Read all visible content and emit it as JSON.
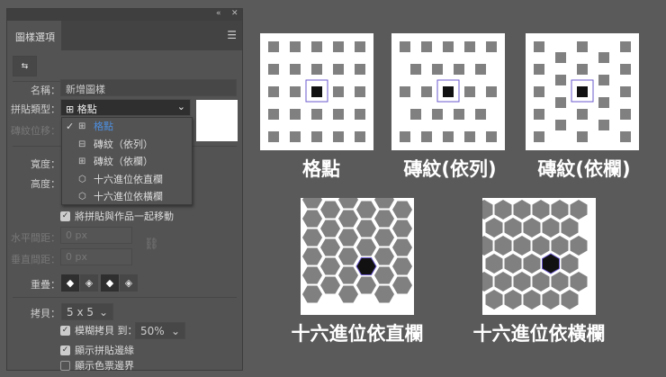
{
  "panel": {
    "title": "圖樣選項",
    "collapse_icon": "«",
    "close_icon": "✕",
    "menu_icon": "☰",
    "fit_tile_icon": "⇆",
    "name_label": "名稱：",
    "name_value": "新增圖樣",
    "tile_type_label": "拼貼類型：",
    "tile_type_value": "格點",
    "brick_offset_label": "磚紋位移：",
    "width_label": "寬度：",
    "height_label": "高度：",
    "tile_types": [
      {
        "icon": "⊞",
        "label": "格點",
        "selected": true
      },
      {
        "icon": "⊟",
        "label": "磚紋（依列）"
      },
      {
        "icon": "⊞",
        "label": "磚紋（依欄）"
      },
      {
        "icon": "⬡",
        "label": "十六進位依直欄"
      },
      {
        "icon": "⬡",
        "label": "十六進位依橫欄"
      }
    ],
    "check_mark": "✓",
    "move_with_art_label": "將拼貼與作品一起移動",
    "h_spacing_label": "水平間距：",
    "h_spacing_value": "0 px",
    "v_spacing_label": "垂直間距：",
    "v_spacing_value": "0 px",
    "overlap_label": "重疊：",
    "copies_label": "拷貝：",
    "copies_value": "5 x 5",
    "dim_copies_label": "模糊拷貝 到：",
    "dim_copies_value": "50%",
    "show_tile_edge_label": "顯示拼貼邊緣",
    "show_swatch_bounds_label": "顯示色票邊界"
  },
  "examples": [
    {
      "type": "grid",
      "caption": "格點"
    },
    {
      "type": "brick-row",
      "caption": "磚紋(依列)"
    },
    {
      "type": "brick-col",
      "caption": "磚紋(依欄)"
    },
    {
      "type": "hex-col",
      "caption": "十六進位依直欄"
    },
    {
      "type": "hex-row",
      "caption": "十六進位依橫欄"
    }
  ],
  "colors": {
    "shape": "#808080",
    "center": "#111111",
    "outline": "#6a5acd"
  }
}
